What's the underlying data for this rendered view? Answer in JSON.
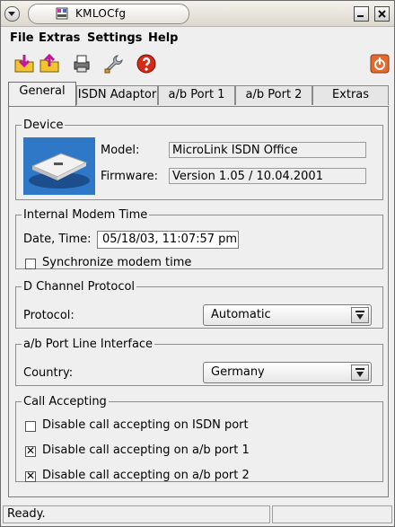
{
  "window": {
    "title": "KMLOCfg"
  },
  "menubar": {
    "items": [
      "File",
      "Extras",
      "Settings",
      "Help"
    ]
  },
  "toolbar": {
    "icons": [
      "load-from-device-icon",
      "save-to-device-icon",
      "printer-icon",
      "wrench-icon",
      "help-icon",
      "power-icon"
    ]
  },
  "tabs": [
    "General",
    "ISDN Adaptor",
    "a/b Port 1",
    "a/b Port 2",
    "Extras"
  ],
  "device": {
    "legend": "Device",
    "model_label": "Model:",
    "model_value": "MicroLink ISDN Office",
    "firmware_label": "Firmware:",
    "firmware_value": "Version 1.05 / 10.04.2001"
  },
  "modem_time": {
    "legend": "Internal Modem Time",
    "date_label": "Date, Time:",
    "date_value": "05/18/03, 11:07:57 pm",
    "sync_label": "Synchronize modem time",
    "sync_checked": false
  },
  "d_channel": {
    "legend": "D Channel Protocol",
    "protocol_label": "Protocol:",
    "protocol_value": "Automatic"
  },
  "ab_line": {
    "legend": "a/b Port Line Interface",
    "country_label": "Country:",
    "country_value": "Germany"
  },
  "call_accepting": {
    "legend": "Call Accepting",
    "options": [
      {
        "label": "Disable call accepting on ISDN port",
        "checked": false
      },
      {
        "label": "Disable call accepting on a/b port 1",
        "checked": true
      },
      {
        "label": "Disable call accepting on a/b port 2",
        "checked": true
      }
    ]
  },
  "status": {
    "text": "Ready."
  },
  "colors": {
    "accent_red": "#d42a16",
    "window_bg": "#efefef"
  }
}
